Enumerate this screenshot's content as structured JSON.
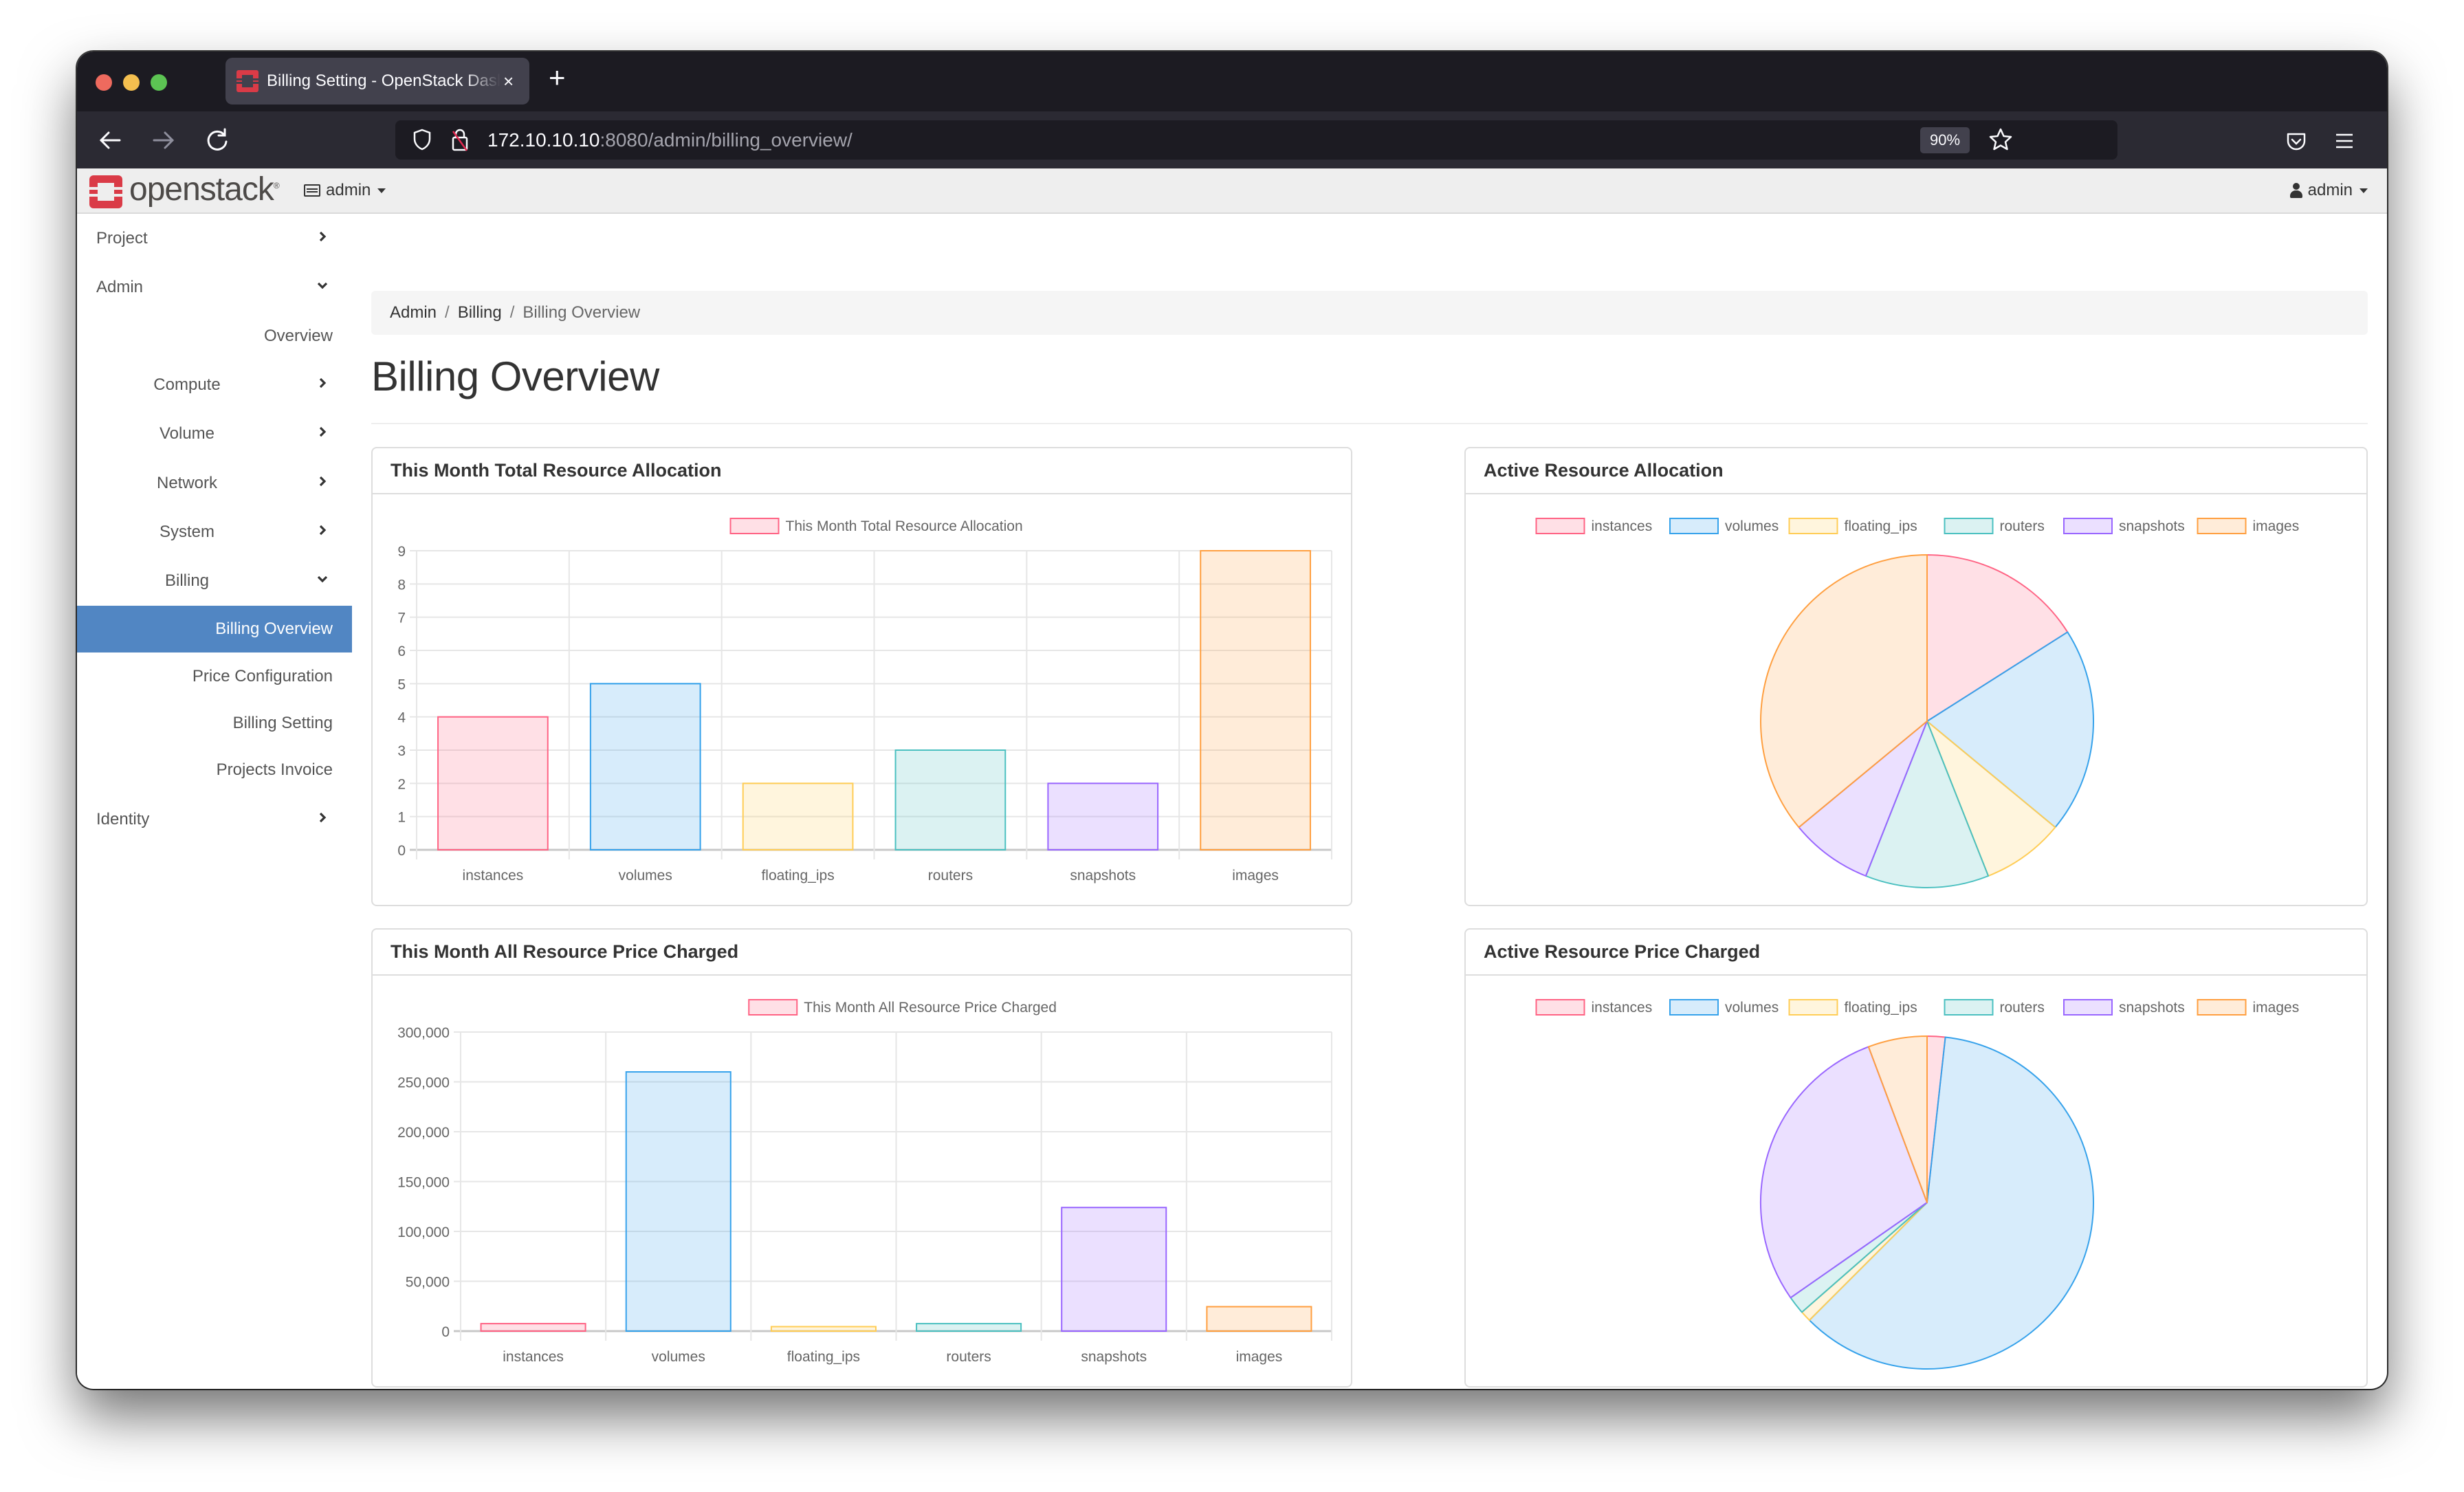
{
  "browser": {
    "tab_title": "Billing Setting - OpenStack Dashboard",
    "tab_close": "×",
    "new_tab": "+",
    "url_host": "172.10.10.10",
    "url_rest": ":8080/admin/billing_overview/",
    "zoom_level": "90%"
  },
  "header": {
    "logo_text": "openstack",
    "project_picker": "admin",
    "user_menu": "admin"
  },
  "sidebar": {
    "items": [
      {
        "label": "Project",
        "level": 0,
        "chevron": "right"
      },
      {
        "label": "Admin",
        "level": 0,
        "chevron": "down"
      },
      {
        "label": "Overview",
        "level": 2
      },
      {
        "label": "Compute",
        "level": 1,
        "chevron": "right"
      },
      {
        "label": "Volume",
        "level": 1,
        "chevron": "right"
      },
      {
        "label": "Network",
        "level": 1,
        "chevron": "right"
      },
      {
        "label": "System",
        "level": 1,
        "chevron": "right"
      },
      {
        "label": "Billing",
        "level": 1,
        "chevron": "down"
      },
      {
        "label": "Billing Overview",
        "level": 2,
        "active": true
      },
      {
        "label": "Price Configuration",
        "level": 2
      },
      {
        "label": "Billing Setting",
        "level": 2
      },
      {
        "label": "Projects Invoice",
        "level": 2
      },
      {
        "label": "Identity",
        "level": 0,
        "chevron": "right"
      }
    ]
  },
  "breadcrumb": [
    "Admin",
    "Billing",
    "Billing Overview"
  ],
  "page_title": "Billing Overview",
  "colors": {
    "instances": "#FF6384",
    "volumes": "#36A2EB",
    "floating_ips": "#FFCD56",
    "routers": "#4BC0C0",
    "snapshots": "#9966FF",
    "images": "#FF9F40",
    "sidebar_active": "#5186c3"
  },
  "chart_data": [
    {
      "type": "bar",
      "title": "This Month Total Resource Allocation",
      "legend": [
        "This Month Total Resource Allocation"
      ],
      "legend_position": "top",
      "categories": [
        "instances",
        "volumes",
        "floating_ips",
        "routers",
        "snapshots",
        "images"
      ],
      "values": [
        4,
        5,
        2,
        3,
        2,
        9
      ],
      "ylim": [
        0,
        9
      ],
      "yticks": [
        0,
        1,
        2,
        3,
        4,
        5,
        6,
        7,
        8,
        9
      ],
      "ytick_labels": [
        "0",
        "1",
        "2",
        "3",
        "4",
        "5",
        "6",
        "7",
        "8",
        "9"
      ],
      "grid": true,
      "xlabel": "",
      "ylabel": ""
    },
    {
      "type": "pie",
      "title": "Active Resource Allocation",
      "legend": [
        "instances",
        "volumes",
        "floating_ips",
        "routers",
        "snapshots",
        "images"
      ],
      "legend_position": "top",
      "categories": [
        "instances",
        "volumes",
        "floating_ips",
        "routers",
        "snapshots",
        "images"
      ],
      "values": [
        4,
        5,
        2,
        3,
        2,
        9
      ]
    },
    {
      "type": "bar",
      "title": "This Month All Resource Price Charged",
      "legend": [
        "This Month All Resource Price Charged"
      ],
      "legend_position": "top",
      "categories": [
        "instances",
        "volumes",
        "floating_ips",
        "routers",
        "snapshots",
        "images"
      ],
      "values": [
        7500,
        260000,
        4500,
        7500,
        124000,
        24500
      ],
      "ylim": [
        0,
        300000
      ],
      "yticks": [
        0,
        50000,
        100000,
        150000,
        200000,
        250000,
        300000
      ],
      "ytick_labels": [
        "0",
        "50,000",
        "100,000",
        "150,000",
        "200,000",
        "250,000",
        "300,000"
      ],
      "grid": true,
      "xlabel": "",
      "ylabel": ""
    },
    {
      "type": "pie",
      "title": "Active Resource Price Charged",
      "legend": [
        "instances",
        "volumes",
        "floating_ips",
        "routers",
        "snapshots",
        "images"
      ],
      "legend_position": "top",
      "categories": [
        "instances",
        "volumes",
        "floating_ips",
        "routers",
        "snapshots",
        "images"
      ],
      "values": [
        7500,
        260000,
        4500,
        7500,
        124000,
        24500
      ]
    }
  ]
}
